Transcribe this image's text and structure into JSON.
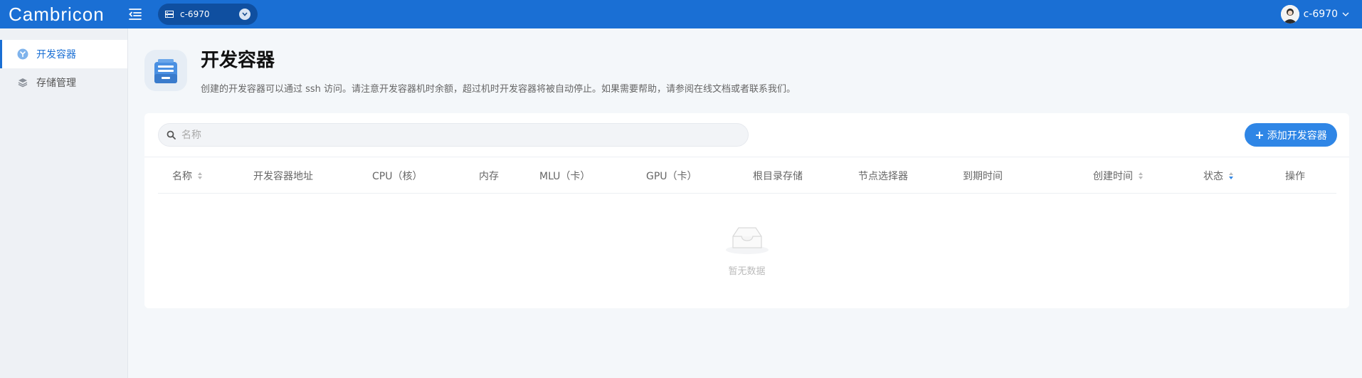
{
  "topbar": {
    "logo": "Cambricon",
    "cluster": "c-6970",
    "username": "c-6970"
  },
  "sidebar": {
    "items": [
      {
        "label": "开发容器",
        "icon": "container-icon",
        "active": true
      },
      {
        "label": "存储管理",
        "icon": "storage-icon",
        "active": false
      }
    ]
  },
  "header": {
    "title": "开发容器",
    "description": "创建的开发容器可以通过 ssh 访问。请注意开发容器机时余额，超过机时开发容器将被自动停止。如果需要帮助，请参阅在线文档或者联系我们。"
  },
  "toolbar": {
    "search_placeholder": "名称",
    "add_label": "添加开发容器"
  },
  "table": {
    "columns": [
      "名称",
      "开发容器地址",
      "CPU（核）",
      "内存",
      "MLU（卡）",
      "GPU（卡）",
      "根目录存储",
      "节点选择器",
      "到期时间",
      "创建时间",
      "状态",
      "操作"
    ],
    "rows": [],
    "empty_text": "暂无数据"
  },
  "colors": {
    "topbar": "#1a6fd4",
    "accent": "#2f86e6"
  }
}
